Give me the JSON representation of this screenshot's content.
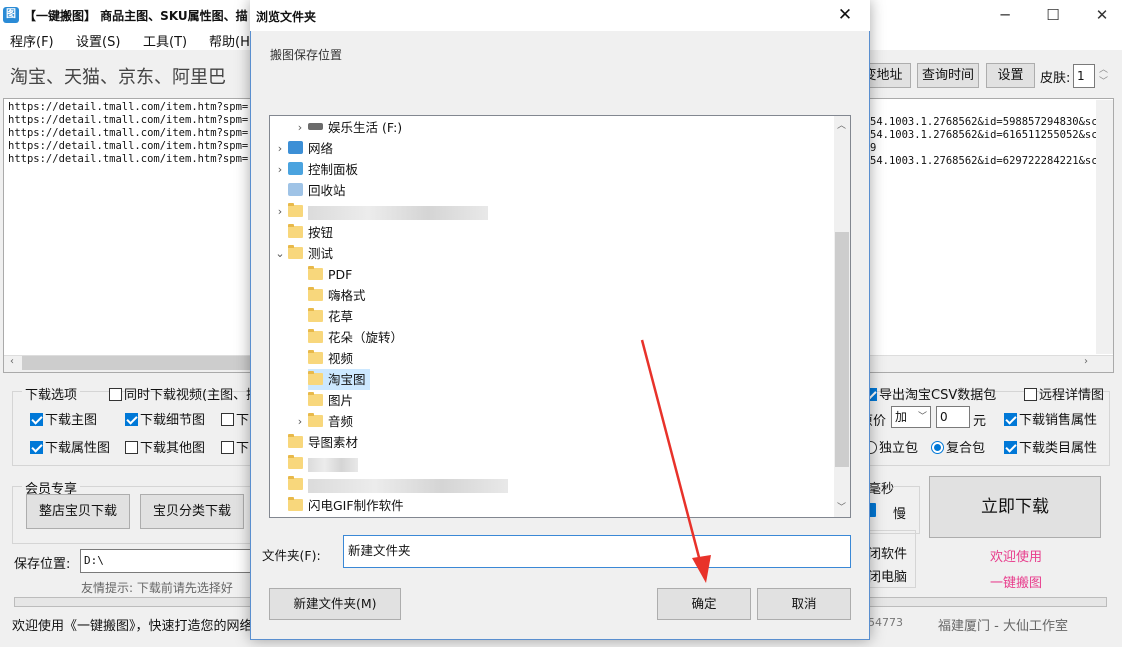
{
  "app": {
    "title": "【一键搬图】 商品主图、SKU属性图、描",
    "icon_letter": "图",
    "minimize": "─",
    "maximize": "☐",
    "close": "✕"
  },
  "menu": [
    "程序(F)",
    "设置(S)",
    "工具(T)",
    "帮助(H)"
  ],
  "slogan": "淘宝、天猫、京东、阿里巴",
  "toolbar": {
    "address": "变地址",
    "query_time": "查询时间",
    "settings": "设置",
    "skin_label": "皮肤:",
    "skin_value": "1"
  },
  "urls_left": [
    "https://detail.tmall.com/item.htm?spm=",
    "https://detail.tmall.com/item.htm?spm=",
    "https://detail.tmall.com/item.htm?spm=",
    "https://detail.tmall.com/item.htm?spm=",
    "https://detail.tmall.com/item.htm?spm="
  ],
  "urls_right": [
    "54.1003.1.2768562&id=598857294830&sc",
    "54.1003.1.2768562&id=616511255052&sc",
    "9",
    "54.1003.1.2768562&id=629722284221&sc"
  ],
  "download_options": {
    "title": "下载选项",
    "video": "同时下载视频(主图、描",
    "main_image": "下载主图",
    "detail_image": "下载细节图",
    "attr_image": "下载属性图",
    "other_image": "下载其他图",
    "partial_1": "下",
    "partial_2": "下"
  },
  "right_options": {
    "export_csv": "导出淘宝CSV数据包",
    "remote_detail": "远程详情图",
    "price_label": "原价",
    "price_op": "加",
    "price_value": "0",
    "price_unit": "元",
    "sales_attr": "下载销售属性",
    "standalone": "独立包",
    "compound": "复合包",
    "category_attr": "下载类目属性"
  },
  "member": {
    "title": "会员专享",
    "shop_download": "整店宝贝下载",
    "category_download": "宝贝分类下载"
  },
  "save": {
    "label": "保存位置:",
    "path": "D:\\",
    "hint": "友情提示: 下载前请先选择好"
  },
  "speed": {
    "label": "毫秒",
    "slow": "慢"
  },
  "power": {
    "line1": "闭软件",
    "line2": "闭电脑"
  },
  "download_now": "立即下载",
  "welcome": {
    "line1": "欢迎使用",
    "line2": "一键搬图"
  },
  "status": {
    "welcome": "欢迎使用《一键搬图》，快速打造您的网络",
    "number": "54773",
    "studio": "福建厦门 - 大仙工作室"
  },
  "dialog": {
    "title": "浏览文件夹",
    "close": "✕",
    "description": "搬图保存位置",
    "folder_label": "文件夹(F):",
    "folder_value": "新建文件夹",
    "new_folder": "新建文件夹(M)",
    "ok": "确定",
    "cancel": "取消"
  },
  "tree": [
    {
      "label": "娱乐生活 (F:)",
      "icon": "drive-icon",
      "expander": "›"
    },
    {
      "label": "网络",
      "icon": "network-icon",
      "expander": "›"
    },
    {
      "label": "控制面板",
      "icon": "control-panel-icon",
      "expander": "›"
    },
    {
      "label": "回收站",
      "icon": "recycle-bin-icon",
      "expander": ""
    },
    {
      "label": "",
      "icon": "folder-icon",
      "expander": "›"
    },
    {
      "label": "按钮",
      "icon": "folder-icon",
      "expander": ""
    },
    {
      "label": "测试",
      "icon": "folder-icon",
      "expander": "⌄"
    },
    {
      "label": "PDF",
      "icon": "folder-icon",
      "expander": ""
    },
    {
      "label": "嗨格式",
      "icon": "folder-icon",
      "expander": ""
    },
    {
      "label": "花草",
      "icon": "folder-icon",
      "expander": ""
    },
    {
      "label": "花朵（旋转）",
      "icon": "folder-icon",
      "expander": ""
    },
    {
      "label": "视频",
      "icon": "folder-icon",
      "expander": ""
    },
    {
      "label": "淘宝图",
      "icon": "folder-icon",
      "expander": "",
      "selected": true
    },
    {
      "label": "图片",
      "icon": "folder-icon",
      "expander": ""
    },
    {
      "label": "音频",
      "icon": "folder-icon",
      "expander": "›"
    },
    {
      "label": "导图素材",
      "icon": "folder-icon",
      "expander": ""
    },
    {
      "label": "",
      "icon": "folder-icon",
      "expander": ""
    },
    {
      "label": "",
      "icon": "folder-icon",
      "expander": ""
    },
    {
      "label": "闪电GIF制作软件",
      "icon": "folder-icon",
      "expander": ""
    }
  ],
  "colors": {
    "accent": "#0078d7",
    "arrow": "#e8322a",
    "welcome_pink": "#e83c8c",
    "selection": "#cce8ff"
  }
}
